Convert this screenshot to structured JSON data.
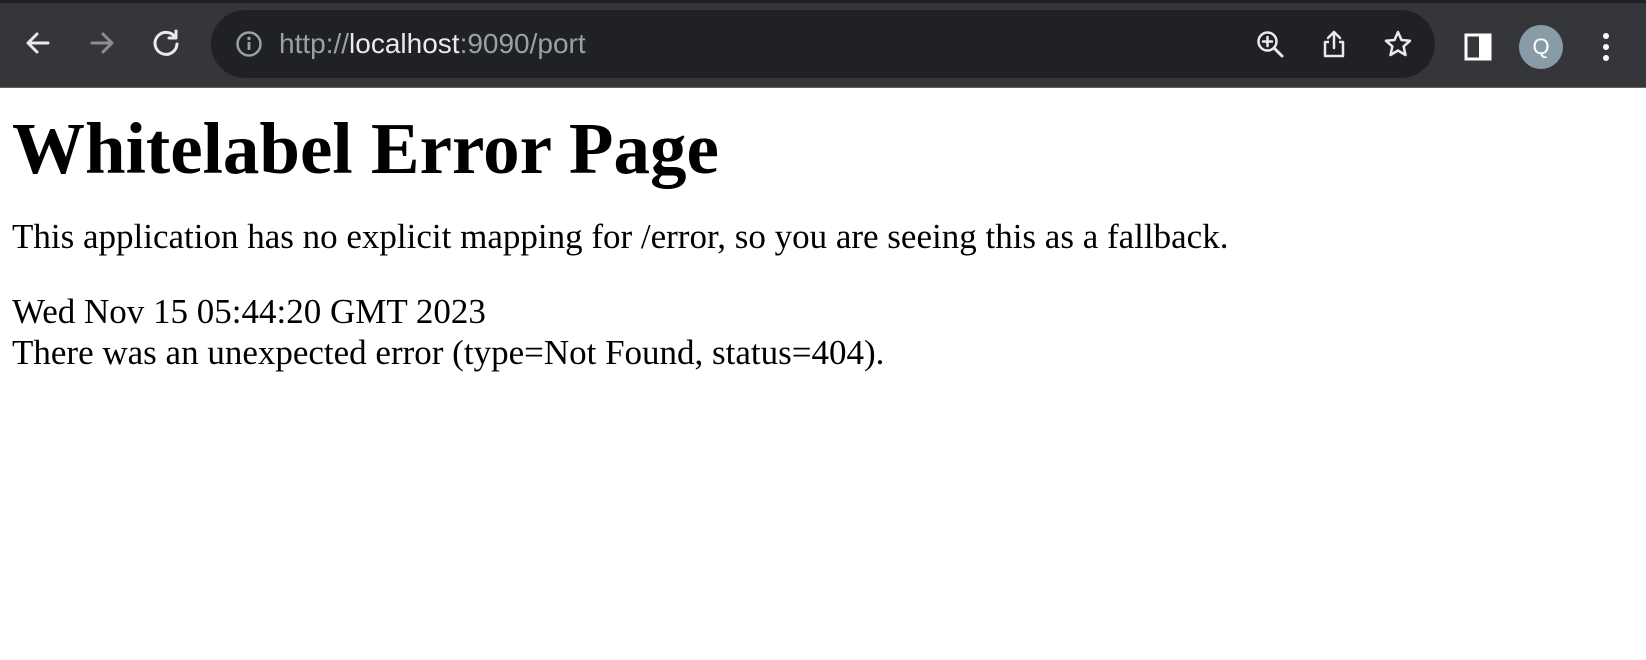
{
  "browser": {
    "url_scheme": "http://",
    "url_host": "localhost",
    "url_rest": ":9090/port",
    "profile_initial": "Q",
    "icons": {
      "back": "back-arrow-icon",
      "forward": "forward-arrow-icon",
      "reload": "reload-icon",
      "site_info": "info-icon",
      "zoom": "zoom-in-icon",
      "share": "share-icon",
      "bookmark": "star-icon",
      "side_panel": "side-panel-icon",
      "menu": "more-vert-icon"
    },
    "colors": {
      "toolbar": "#35363a",
      "omnibox": "#202124",
      "avatar": "#8a9ba8"
    }
  },
  "page": {
    "title": "Whitelabel Error Page",
    "message": "This application has no explicit mapping for /error, so you are seeing this as a fallback.",
    "timestamp": "Wed Nov 15 05:44:20 GMT 2023",
    "error_detail": "There was an unexpected error (type=Not Found, status=404)."
  }
}
